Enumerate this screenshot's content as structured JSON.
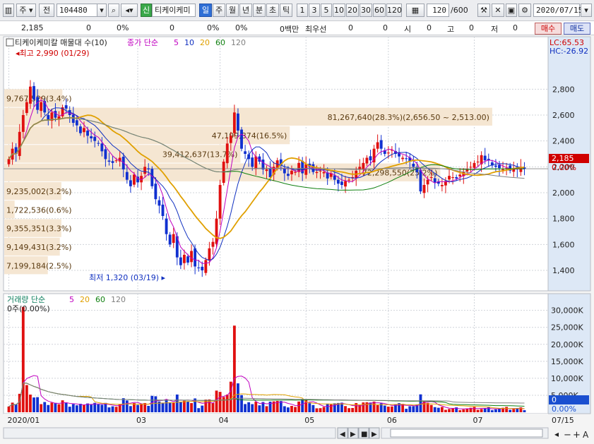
{
  "toolbar": {
    "type_label": "주",
    "period_label": "전",
    "code": "104480",
    "badge": "신",
    "name": "티케이케미",
    "periods": [
      "일",
      "주",
      "월",
      "년",
      "분",
      "초",
      "틱"
    ],
    "selected_period": "일",
    "minutes": [
      "1",
      "3",
      "5",
      "10",
      "20",
      "30",
      "60",
      "120"
    ],
    "count": "120",
    "total": "/600",
    "date": "2020/07/15"
  },
  "quote": {
    "price": "2,185",
    "v1": "0",
    "p1": "0%",
    "v2": "0",
    "p2": "0%",
    "unit": "0백만",
    "best_label": "최우선",
    "b1": "0",
    "b2": "0",
    "open_label": "시",
    "open": "0",
    "high_label": "고",
    "high": "0",
    "low_label": "저",
    "low": "0",
    "buy": "매수",
    "sell": "매도"
  },
  "price_panel": {
    "title": "티케이케미칼 매물대 수(10)",
    "ma_label": "종가 단순",
    "ma_periods": [
      "5",
      "10",
      "20",
      "60",
      "120"
    ],
    "ma_colors": [
      "#c000c0",
      "#1030c0",
      "#e0a000",
      "#108010",
      "#808080"
    ],
    "lc": "LC:65.53",
    "hc": "HC:-26.92",
    "max_label": "최고 2,990 (01/29)",
    "min_label": "최저 1,320 (03/19)",
    "current": "2,185",
    "current_pct": "0.00%",
    "y_ticks": [
      "2,800",
      "2,600",
      "2,400",
      "2,200",
      "2,000",
      "1,800",
      "1,600",
      "1,400"
    ],
    "y_tick_values": [
      2800,
      2600,
      2400,
      2200,
      2000,
      1800,
      1600,
      1400
    ],
    "y_min": 1280,
    "y_max": 3080,
    "volume_profile": [
      {
        "low": 2656.5,
        "high": 2800,
        "label": "9,767,529(3.4%)",
        "width": 0.112
      },
      {
        "low": 2513,
        "high": 2656.5,
        "label": "81,267,640(28.3%)(2,656.50 ~ 2,513.00)",
        "width": 0.94
      },
      {
        "low": 2369.5,
        "high": 2513,
        "label": "47,199,874(16.5%)",
        "width": 0.55
      },
      {
        "low": 2226,
        "high": 2369.5,
        "label": "39,412,637(13.7%)",
        "width": 0.455
      },
      {
        "low": 2082.5,
        "high": 2226,
        "label": "72,298,550(25.2%)",
        "width": 0.84
      },
      {
        "low": 1939,
        "high": 2082.5,
        "label": "9,235,002(3.2%)",
        "width": 0.11
      },
      {
        "low": 1795.5,
        "high": 1939,
        "label": "1,722,536(0.6%)",
        "width": 0.02
      },
      {
        "low": 1652,
        "high": 1795.5,
        "label": "9,355,351(3.3%)",
        "width": 0.11
      },
      {
        "low": 1508.5,
        "high": 1652,
        "label": "9,149,431(3.2%)",
        "width": 0.107
      },
      {
        "low": 1365,
        "high": 1508.5,
        "label": "7,199,184(2.5%)",
        "width": 0.084
      }
    ]
  },
  "volume_panel": {
    "title": "거래량 단순",
    "ma_periods": [
      "5",
      "20",
      "60",
      "120"
    ],
    "ma_colors": [
      "#c000c0",
      "#e0a000",
      "#108010",
      "#808080"
    ],
    "info": "0주(0.00%)",
    "y_ticks": [
      "30,000K",
      "25,000K",
      "20,000K",
      "15,000K",
      "10,000K",
      "5,000K"
    ],
    "y_tick_values": [
      30000,
      25000,
      20000,
      15000,
      10000,
      5000
    ],
    "y_max": 32000,
    "current": "0",
    "current_pct": "0.00%"
  },
  "x_axis": {
    "labels": [
      "2020/01",
      "03",
      "04",
      "05",
      "06",
      "07"
    ],
    "label_index": [
      0,
      36,
      59,
      83,
      106,
      130
    ],
    "end_label": "07/15"
  },
  "nav": {
    "prev": "◀",
    "play": "▶",
    "stop": "■",
    "next": "▶",
    "minus": "−",
    "plus": "+",
    "auto": "A"
  },
  "chart_data": {
    "type": "candlestick",
    "n": 145,
    "x_first": "2020/01",
    "x_last": "07/15",
    "close": [
      2260,
      2340,
      2300,
      2470,
      2600,
      2700,
      2820,
      2720,
      2640,
      2700,
      2620,
      2560,
      2620,
      2580,
      2590,
      2660,
      2650,
      2600,
      2540,
      2520,
      2460,
      2500,
      2440,
      2420,
      2400,
      2380,
      2320,
      2260,
      2240,
      2230,
      2250,
      2270,
      2180,
      2100,
      2050,
      2140,
      2080,
      2130,
      2200,
      2180,
      2050,
      1950,
      1900,
      1820,
      1680,
      1600,
      1680,
      1500,
      1440,
      1520,
      1460,
      1550,
      1430,
      1420,
      1400,
      1480,
      1570,
      1620,
      1800,
      2060,
      2240,
      2380,
      2440,
      2620,
      2480,
      2340,
      2300,
      2260,
      2200,
      2280,
      2240,
      2180,
      2180,
      2120,
      2200,
      2250,
      2210,
      2150,
      2130,
      2170,
      2160,
      2230,
      2150,
      2220,
      2200,
      2160,
      2160,
      2170,
      2160,
      2110,
      2150,
      2100,
      2070,
      2060,
      2090,
      2100,
      2120,
      2170,
      2200,
      2230,
      2270,
      2250,
      2340,
      2390,
      2340,
      2300,
      2310,
      2330,
      2300,
      2280,
      2270,
      2260,
      2240,
      2200,
      2160,
      2010,
      2060,
      2100,
      2120,
      2080,
      2070,
      2060,
      2090,
      2130,
      2120,
      2110,
      2140,
      2160,
      2180,
      2200,
      2230,
      2240,
      2290,
      2250,
      2250,
      2210,
      2200,
      2190,
      2180,
      2190,
      2170,
      2190,
      2180,
      2200,
      2185
    ]
  }
}
